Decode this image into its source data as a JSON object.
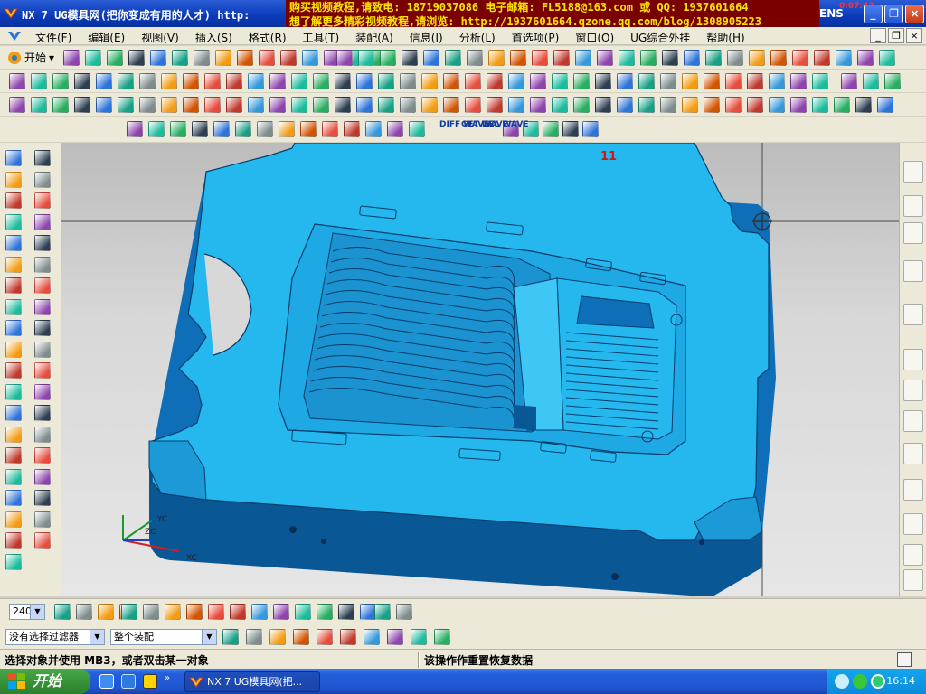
{
  "window": {
    "title": "NX 7 UG模具网(把你变成有用的人才) http:",
    "banner_line1": "购买视频教程,请致电: 18719037086 电子邮箱: FL5188@163.com 或 QQ: 1937601664",
    "banner_line2": "想了解更多精彩视频教程,请浏览: http://1937601664.qzone.qq.com/blog/1308905223",
    "brand": "ENS",
    "overlay_time": "0:07:43",
    "minimize": "_",
    "restore": "❐",
    "close": "×"
  },
  "menu": {
    "items": [
      "文件(F)",
      "编辑(E)",
      "视图(V)",
      "插入(S)",
      "格式(R)",
      "工具(T)",
      "装配(A)",
      "信息(I)",
      "分析(L)",
      "首选项(P)",
      "窗口(O)",
      "UG综合外挂",
      "帮助(H)"
    ],
    "mdi_minimize": "_",
    "mdi_restore": "❐",
    "mdi_close": "×"
  },
  "standard_toolbar": {
    "start_label": "开始"
  },
  "mold_toolbar": {
    "diff_wave": "DIFF WAVE",
    "get_wave": "GET WAVE",
    "del_wave": "DEL WAVE"
  },
  "viewport": {
    "view_number": "11",
    "axis_xc": "XC",
    "axis_yc": "YC",
    "axis_zc": "ZC"
  },
  "bottom": {
    "zoom_value": "240",
    "filter_value": "没有选择过滤器",
    "scope_value": "整个装配"
  },
  "status": {
    "prompt": "选择对象并使用 MB3，或者双击某一对象",
    "message": "该操作作重置恢复数据"
  },
  "taskbar": {
    "start_label": "开始",
    "task_label": "NX 7 UG模具网(把...",
    "time": "16:14"
  },
  "colors": {
    "model_top": "#25b8ee",
    "model_side": "#0e6fb8",
    "model_dark": "#0a5796",
    "banner_bg": "#7a0000",
    "banner_text": "#ffe600"
  }
}
